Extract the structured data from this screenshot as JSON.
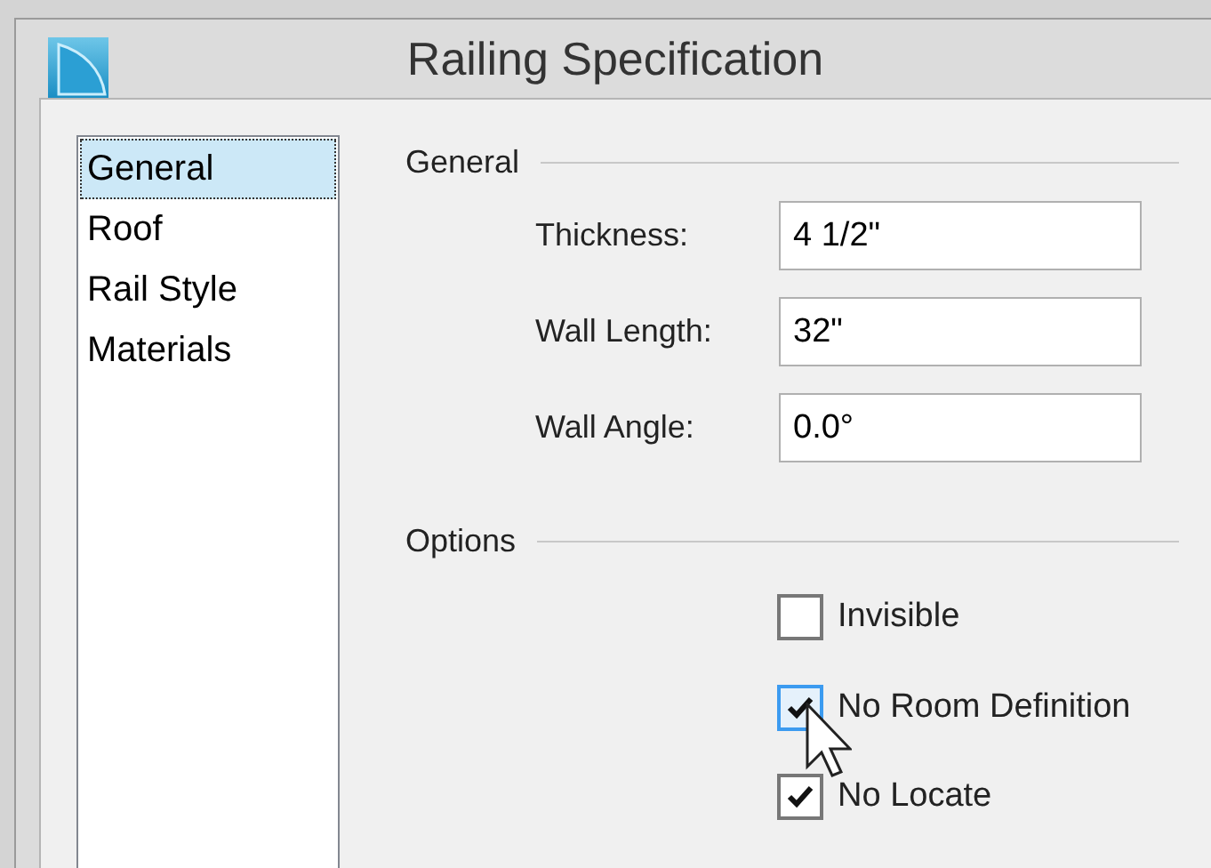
{
  "window": {
    "title": "Railing Specification"
  },
  "sidebar": {
    "items": [
      {
        "label": "General",
        "selected": true
      },
      {
        "label": "Roof",
        "selected": false
      },
      {
        "label": "Rail Style",
        "selected": false
      },
      {
        "label": "Materials",
        "selected": false
      }
    ]
  },
  "general": {
    "heading": "General",
    "fields": [
      {
        "label": "Thickness:",
        "value": "4 1/2\""
      },
      {
        "label": "Wall Length:",
        "value": "32\""
      },
      {
        "label": "Wall Angle:",
        "value": "0.0°"
      }
    ]
  },
  "options": {
    "heading": "Options",
    "items": [
      {
        "label": "Invisible",
        "checked": false,
        "focused": false
      },
      {
        "label": "No Room Definition",
        "checked": true,
        "focused": true
      },
      {
        "label": "No Locate",
        "checked": true,
        "focused": false
      }
    ]
  }
}
